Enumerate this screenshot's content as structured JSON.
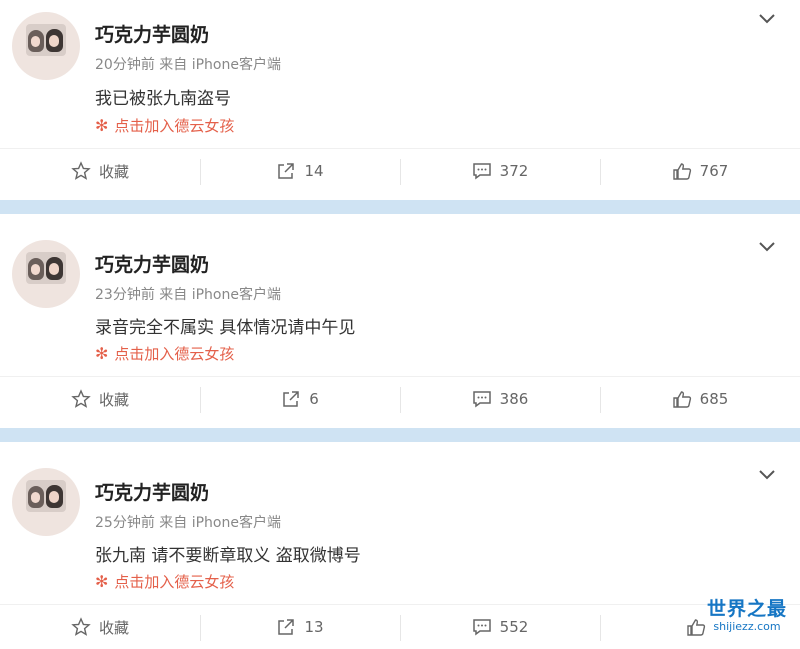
{
  "posts": [
    {
      "username": "巧克力芋圆奶",
      "meta": "20分钟前 来自 iPhone客户端",
      "content": "我已被张九南盗号",
      "badge": "点击加入德云女孩",
      "actions": {
        "favorite": "收藏",
        "repost": "14",
        "comment": "372",
        "like": "767"
      }
    },
    {
      "username": "巧克力芋圆奶",
      "meta": "23分钟前 来自 iPhone客户端",
      "content": "录音完全不属实 具体情况请中午见",
      "badge": "点击加入德云女孩",
      "actions": {
        "favorite": "收藏",
        "repost": "6",
        "comment": "386",
        "like": "685"
      }
    },
    {
      "username": "巧克力芋圆奶",
      "meta": "25分钟前 来自 iPhone客户端",
      "content": "张九南 请不要断章取义 盗取微博号",
      "badge": "点击加入德云女孩",
      "actions": {
        "favorite": "收藏",
        "repost": "13",
        "comment": "552",
        "like": ""
      }
    }
  ],
  "watermark": {
    "title": "世界之最",
    "domain": "shijiezz.com"
  },
  "colors": {
    "separator": "#cfe3f3",
    "badge": "#e4604a",
    "watermark": "#1676c4"
  }
}
